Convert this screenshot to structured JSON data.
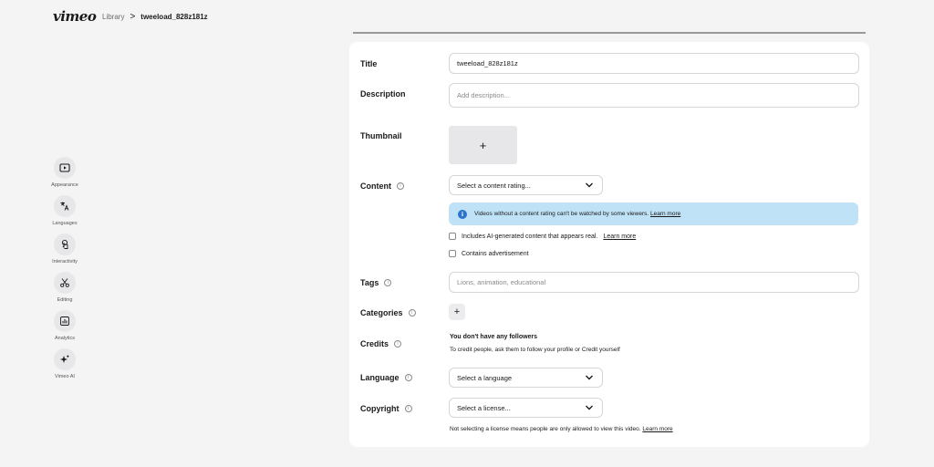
{
  "header": {
    "logo": "vimeo",
    "breadcrumb": {
      "library": "Library",
      "separator": ">",
      "current": "tweeload_828z181z"
    }
  },
  "sidebar": {
    "items": [
      {
        "label": "Appearance",
        "icon": "play-icon"
      },
      {
        "label": "Languages",
        "icon": "translate-icon"
      },
      {
        "label": "Interactivity",
        "icon": "tap-icon"
      },
      {
        "label": "Editing",
        "icon": "scissors-icon"
      },
      {
        "label": "Analytics",
        "icon": "chart-icon"
      },
      {
        "label": "Vimeo AI",
        "icon": "sparkle-icon"
      }
    ]
  },
  "form": {
    "title": {
      "label": "Title",
      "value": "tweeload_828z181z"
    },
    "description": {
      "label": "Description",
      "placeholder": "Add description..."
    },
    "thumbnail": {
      "label": "Thumbnail",
      "add": "+"
    },
    "content": {
      "label": "Content",
      "select_value": "Select a content rating...",
      "notice_text": "Videos without a content rating can't be watched by some viewers.",
      "notice_link": "Learn more",
      "checkbox_ai": "Includes AI-generated content that appears real.",
      "checkbox_ai_link": "Learn more",
      "checkbox_ad": "Contains advertisement"
    },
    "tags": {
      "label": "Tags",
      "placeholder": "Lions, animation, educational"
    },
    "categories": {
      "label": "Categories",
      "add": "+"
    },
    "credits": {
      "label": "Credits",
      "title": "You don't have any followers",
      "subtitle": "To credit people, ask them to follow your profile or Credit yourself"
    },
    "language": {
      "label": "Language",
      "select_value": "Select a language"
    },
    "copyright": {
      "label": "Copyright",
      "select_value": "Select a license...",
      "note": "Not selecting a license means people are only allowed to view this video.",
      "note_link": "Learn more"
    }
  },
  "colors": {
    "background": "#f4f4f5",
    "panel": "#ffffff",
    "notice_bg": "#bfe2f7",
    "info_blue": "#2b74c9"
  }
}
